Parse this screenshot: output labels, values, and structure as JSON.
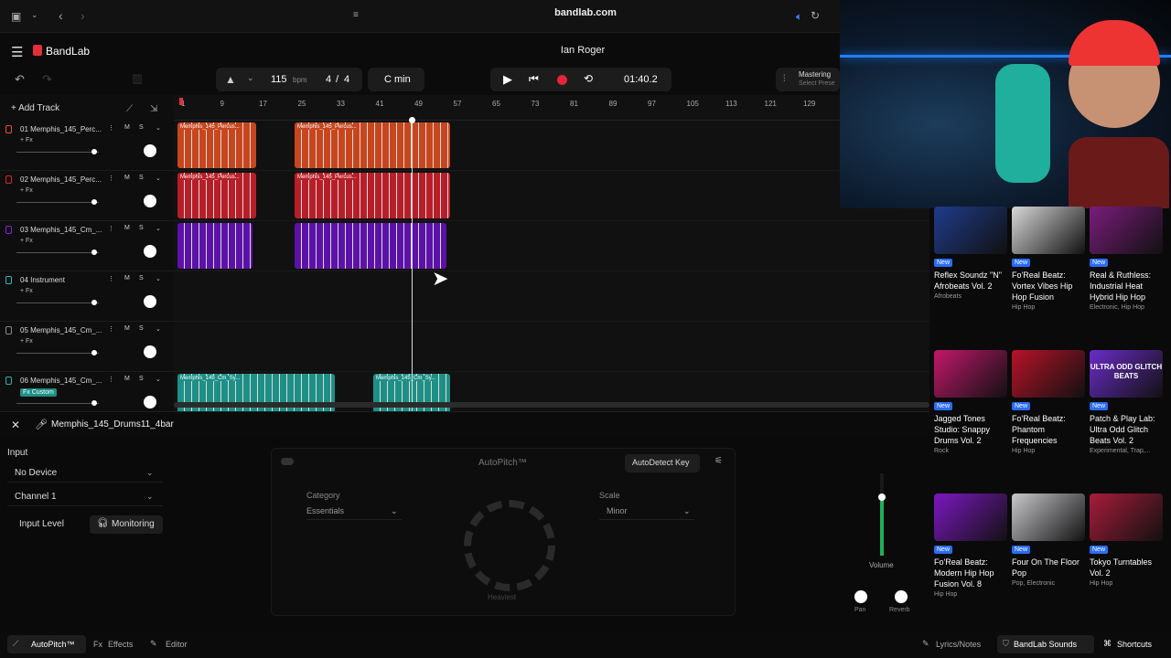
{
  "browser": {
    "url": "bandlab.com"
  },
  "app": {
    "brand": "BandLab",
    "project_title": "Ian Roger"
  },
  "toolbar": {
    "bpm_value": "115",
    "bpm_unit": "bpm",
    "time_sig_num": "4",
    "time_sig_sep": "/",
    "time_sig_den": "4",
    "key": "C min",
    "time": "01:40.2",
    "mastering": "Mastering",
    "mastering_sub": "Select Prese"
  },
  "tracks_header": {
    "add_track": "Add Track"
  },
  "ruler": [
    "1",
    "9",
    "17",
    "25",
    "33",
    "41",
    "49",
    "57",
    "65",
    "73",
    "81",
    "89",
    "97",
    "105",
    "113",
    "121",
    "129"
  ],
  "tracks": [
    {
      "number": "01",
      "name": "Memphis_145_Perc...",
      "fx": "+ Fx",
      "m": "M",
      "s": "S",
      "color": "#e0542a"
    },
    {
      "number": "02",
      "name": "Memphis_145_Perc...",
      "fx": "+ Fx",
      "m": "M",
      "s": "S",
      "color": "#d8262e"
    },
    {
      "number": "03",
      "name": "Memphis_145_Cm_...",
      "fx": "+ Fx",
      "m": "M",
      "s": "S",
      "color": "#8e1fd6"
    },
    {
      "number": "04",
      "name": "Instrument",
      "fx": "+ Fx",
      "m": "M",
      "s": "S",
      "color": "#2bb"
    },
    {
      "number": "05",
      "name": "Memphis_145_Cm_...",
      "fx": "+ Fx",
      "m": "M",
      "s": "S",
      "color": "#888"
    },
    {
      "number": "06",
      "name": "Memphis_145_Cm_...",
      "fx": "Fx Custom",
      "m": "M",
      "s": "S",
      "color": "#22b3a6"
    }
  ],
  "clips": {
    "percus_label": "Memphis_145_Percus...",
    "synth_label": "Memphis_145_Cm_Sy..."
  },
  "bottom": {
    "track_name": "Memphis_145_Drums11_4bar",
    "input_label": "Input",
    "device": "No Device",
    "channel": "Channel 1",
    "input_level": "Input Level",
    "monitoring": "Monitoring",
    "autopitch_title": "AutoPitch™",
    "autodetect": "AutoDetect Key",
    "category_label": "Category",
    "category_value": "Essentials",
    "scale_label": "Scale",
    "scale_value": "Minor",
    "knob_label": "Heaviest",
    "volume": "Volume",
    "pan": "Pan",
    "reverb": "Reverb"
  },
  "footer": {
    "autopitch": "AutoPitch™",
    "effects": "Effects",
    "editor": "Editor",
    "lyrics": "Lyrics/Notes",
    "sounds": "BandLab Sounds",
    "shortcuts": "Shortcuts"
  },
  "sounds": [
    {
      "new": "New",
      "title": "Reflex Soundz \"N\" Afrobeats Vol. 2",
      "genre": "Afrobeats",
      "color": "#1f3b8c"
    },
    {
      "new": "New",
      "title": "Fo'Real Beatz: Vortex Vibes Hip Hop Fusion",
      "genre": "Hip Hop",
      "color": "#d8d8d8"
    },
    {
      "new": "New",
      "title": "Real & Ruthless: Industrial Heat Hybrid Hip Hop",
      "genre": "Electronic, Hip Hop",
      "color": "#7a1c7c"
    },
    {
      "new": "New",
      "title": "Jagged Tones Studio: Snappy Drums Vol. 2",
      "genre": "Rock",
      "color": "#c2176a"
    },
    {
      "new": "New",
      "title": "Fo'Real Beatz: Phantom Frequencies",
      "genre": "Hip Hop",
      "color": "#b81228"
    },
    {
      "new": "New",
      "title": "Patch & Play Lab: Ultra Odd Glitch Beats Vol. 2",
      "genre": "Experimental, Trap,...",
      "color": "#6a2cc8"
    },
    {
      "new": "New",
      "title": "Fo'Real Beatz: Modern Hip Hop Fusion Vol. 8",
      "genre": "Hip Hop",
      "color": "#7d17c2"
    },
    {
      "new": "New",
      "title": "Four On The Floor Pop",
      "genre": "Pop, Electronic",
      "color": "#c8c8cc"
    },
    {
      "new": "New",
      "title": "Tokyo Turntables Vol. 2",
      "genre": "Hip Hop",
      "color": "#a81c3a"
    }
  ],
  "sounds_art_text": "ULTRA ODD GLITCH BEATS"
}
